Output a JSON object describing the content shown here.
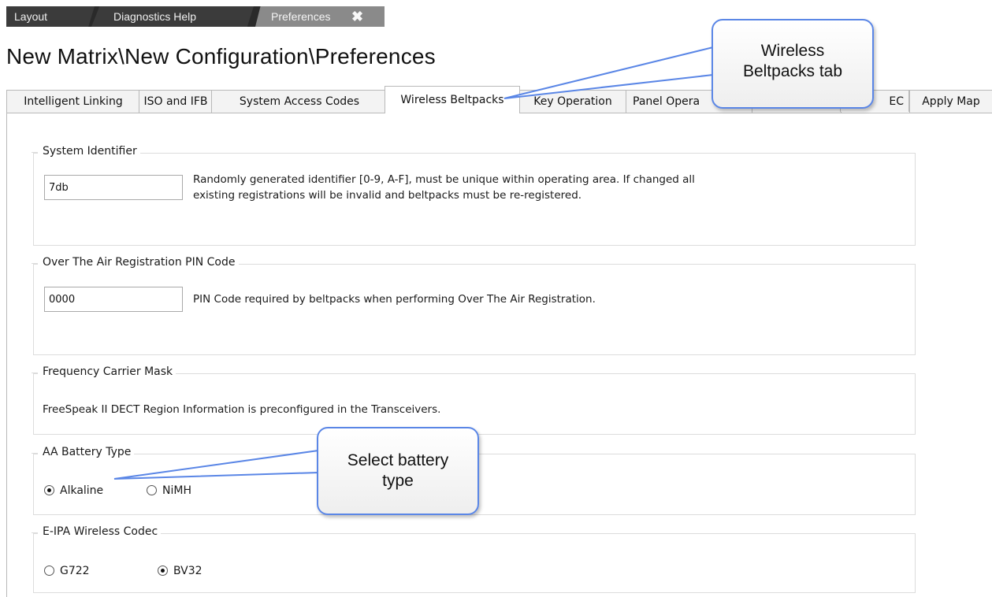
{
  "doc_tabs": {
    "layout": "Layout",
    "diagnostics": "Diagnostics Help",
    "preferences": "Preferences",
    "close_glyph": "✖"
  },
  "page_title": "New Matrix\\New Configuration\\Preferences",
  "pref_tabs": [
    {
      "label": "Intelligent Linking"
    },
    {
      "label": "ISO and IFB"
    },
    {
      "label": "System Access Codes"
    },
    {
      "label": "Wireless Beltpacks",
      "active": true
    },
    {
      "label": "Key Operation"
    },
    {
      "label": "Panel Opera"
    },
    {
      "label": ""
    },
    {
      "label": "EC"
    },
    {
      "label": "Apply Map"
    }
  ],
  "system_identifier": {
    "legend": "System Identifier",
    "value": "7db",
    "description_line1": "Randomly generated identifier [0-9, A-F], must be unique within operating area.  If changed all",
    "description_line2": "existing registrations will be invalid and beltpacks must be re-registered."
  },
  "ota_pin": {
    "legend": "Over The Air Registration PIN Code",
    "value": "0000",
    "description": "PIN Code required by beltpacks when performing Over The Air Registration."
  },
  "frequency_mask": {
    "legend": "Frequency Carrier Mask",
    "description": "FreeSpeak II DECT Region Information is preconfigured in the Transceivers."
  },
  "battery_type": {
    "legend": "AA Battery Type",
    "options": [
      {
        "label": "Alkaline",
        "selected": true
      },
      {
        "label": "NiMH",
        "selected": false
      }
    ]
  },
  "codec": {
    "legend": "E-IPA Wireless Codec",
    "options": [
      {
        "label": "G722",
        "selected": false
      },
      {
        "label": "BV32",
        "selected": true
      }
    ]
  },
  "callouts": {
    "tab": {
      "line1": "Wireless",
      "line2": "Beltpacks tab"
    },
    "battery": {
      "line1": "Select battery",
      "line2": "type"
    }
  },
  "colors": {
    "callout_border": "#5a86e6",
    "doc_tab_dark": "#3b3b3b",
    "doc_tab_active": "#8a8a8a"
  }
}
